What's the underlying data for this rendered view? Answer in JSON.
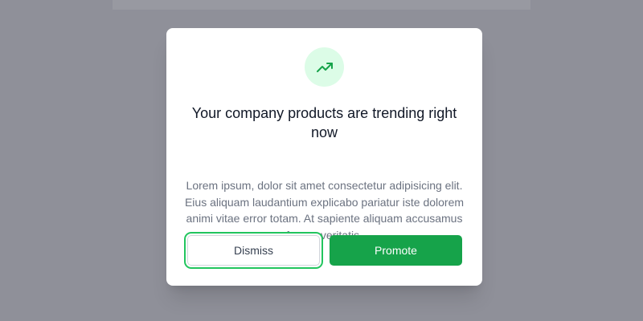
{
  "modal": {
    "icon": "trending-up-icon",
    "title": "Your company products are trending right now",
    "body": "Lorem ipsum, dolor sit amet consectetur adipisicing elit. Eius aliquam laudantium explicabo pariatur iste dolorem animi vitae error totam. At sapiente aliquam accusamus facere veritatis.",
    "dismiss_label": "Dismiss",
    "promote_label": "Promote"
  },
  "colors": {
    "accent": "#16a34a",
    "icon_bg": "#dcfce7",
    "overlay": "#8f9099"
  }
}
